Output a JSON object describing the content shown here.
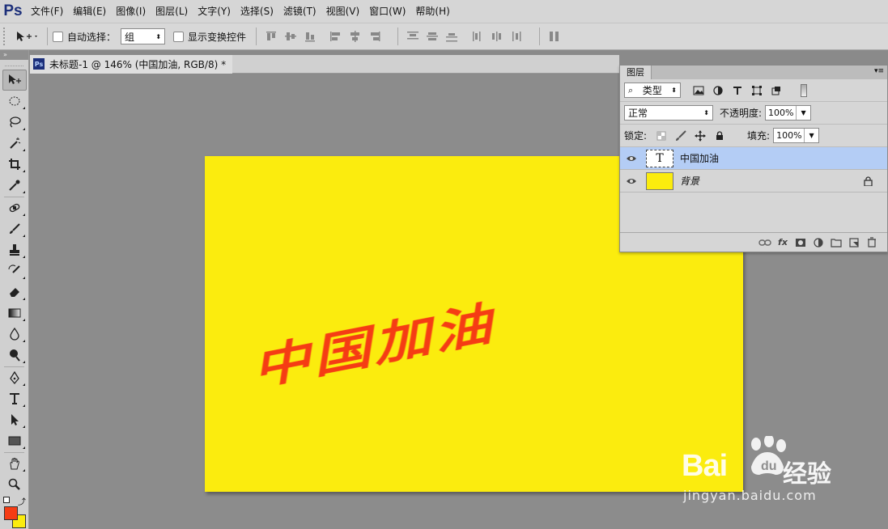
{
  "app": {
    "logo": "Ps"
  },
  "menu": [
    "文件(F)",
    "编辑(E)",
    "图像(I)",
    "图层(L)",
    "文字(Y)",
    "选择(S)",
    "滤镜(T)",
    "视图(V)",
    "窗口(W)",
    "帮助(H)"
  ],
  "options": {
    "auto_select_label": "自动选择：",
    "auto_select_value": "组",
    "show_transform_label": "显示变换控件"
  },
  "document": {
    "tab_title": "未标题-1 @ 146% (中国加油, RGB/8) *",
    "canvas_text": "中国加油",
    "canvas_color": "#fbec0e",
    "text_color": "#f53c14"
  },
  "layers_panel": {
    "tab": "图层",
    "filter_label": "类型",
    "blend_mode": "正常",
    "opacity_label": "不透明度:",
    "opacity_value": "100%",
    "lock_label": "锁定:",
    "fill_label": "填充:",
    "fill_value": "100%",
    "layers": [
      {
        "name": "中国加油",
        "kind": "text",
        "active": true
      },
      {
        "name": "背景",
        "kind": "background",
        "active": false
      }
    ],
    "footer_fx": "fx"
  },
  "watermark": {
    "brand": "Bai",
    "product": "经验",
    "url": "jingyan.baidu.com"
  },
  "colors": {
    "foreground": "#f53c14",
    "background": "#fbec0e"
  }
}
